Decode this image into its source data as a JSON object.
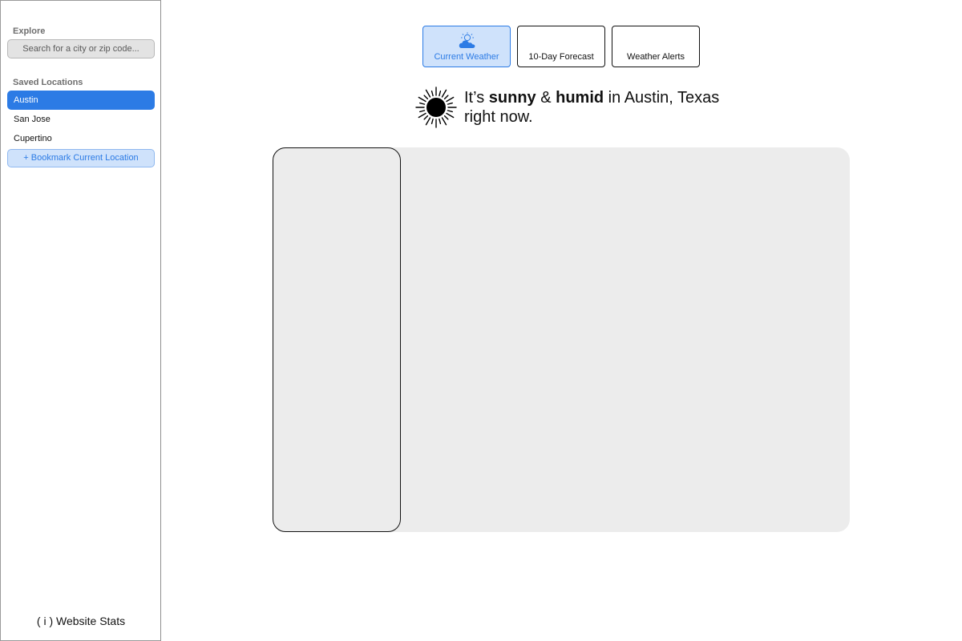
{
  "sidebar": {
    "explore_label": "Explore",
    "search_placeholder": "Search for a city or zip code...",
    "saved_label": "Saved Locations",
    "locations": [
      {
        "label": "Austin",
        "selected": true
      },
      {
        "label": "San Jose",
        "selected": false
      },
      {
        "label": "Cupertino",
        "selected": false
      }
    ],
    "bookmark_label": "+ Bookmark Current Location",
    "stats_label": "( i ) Website Stats"
  },
  "tabs": [
    {
      "label": "Current Weather",
      "active": true,
      "icon": "partly-cloudy-icon"
    },
    {
      "label": "10-Day Forecast",
      "active": false
    },
    {
      "label": "Weather Alerts",
      "active": false
    }
  ],
  "headline": {
    "icon": "sun-icon",
    "prefix": "It’s ",
    "condition1": "sunny",
    "joiner": " & ",
    "condition2": "humid",
    "location_text": " in Austin, Texas",
    "line2": "right now."
  },
  "colors": {
    "accent": "#2c7be5",
    "accent_light": "#cfe2fb",
    "panel_bg": "#ececec"
  }
}
